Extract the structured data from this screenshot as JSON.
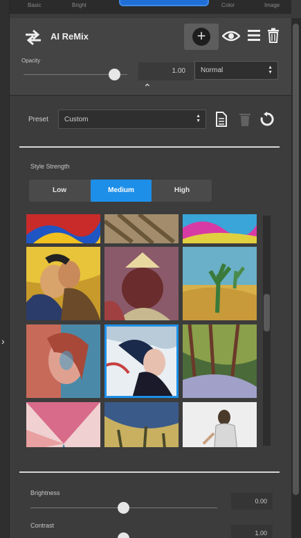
{
  "top_tabs": [
    "Basic",
    "Bright",
    "Color",
    "Image"
  ],
  "layer": {
    "title": "AI ReMix"
  },
  "opacity": {
    "label": "Opacity",
    "value": "1.00"
  },
  "blend_mode": {
    "selected": "Normal"
  },
  "preset": {
    "label": "Preset",
    "selected": "Custom"
  },
  "style_strength": {
    "label": "Style Strength",
    "options": [
      "Low",
      "Medium",
      "High"
    ],
    "selected": "Medium"
  },
  "adjustments": [
    {
      "label": "Brightness",
      "value": "0.00"
    },
    {
      "label": "Contrast",
      "value": "1.00"
    }
  ],
  "colors": {
    "accent": "#1e8fe8",
    "panel": "#3c3c3c",
    "header": "#444444"
  }
}
